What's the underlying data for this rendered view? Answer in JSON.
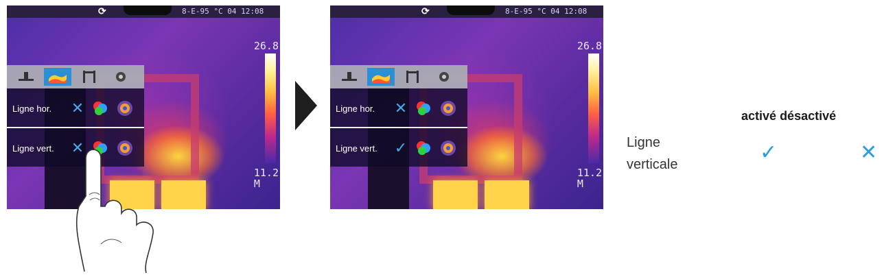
{
  "screens": [
    {
      "status": {
        "refresh_icon": "refresh-icon",
        "text": "8-E-95 °C 04 12:08"
      },
      "scale": {
        "max": "26.8",
        "min_line1": "11.2",
        "min_line2": "M"
      },
      "toolbar_icons": [
        "horizontal-line-icon",
        "palette-icon",
        "vertical-line-icon",
        "settings-icon"
      ],
      "rows": [
        {
          "label": "Ligne hor.",
          "state": "off"
        },
        {
          "label": "Ligne vert.",
          "state": "off"
        }
      ]
    },
    {
      "status": {
        "refresh_icon": "refresh-icon",
        "text": "8-E-95 °C 04 12:08"
      },
      "scale": {
        "max": "26.8",
        "min_line1": "11.2",
        "min_line2": "M"
      },
      "toolbar_icons": [
        "horizontal-line-icon",
        "palette-icon",
        "vertical-line-icon",
        "settings-icon"
      ],
      "rows": [
        {
          "label": "Ligne hor.",
          "state": "off"
        },
        {
          "label": "Ligne vert.",
          "state": "on"
        }
      ]
    }
  ],
  "legend": {
    "title_on": "activé",
    "title_off": "désactivé",
    "label_line1": "Ligne",
    "label_line2": "verticale"
  },
  "colors": {
    "accent": "#2a9de0",
    "arrow": "#1e1e1e"
  }
}
